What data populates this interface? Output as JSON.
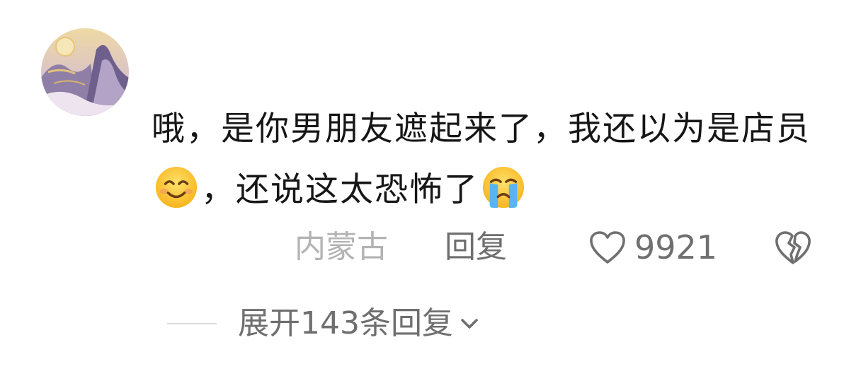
{
  "comment": {
    "avatar_icon": "landscape-painting-avatar",
    "text_part1": "哦，是你男朋友遮起来了，我还以为是店员",
    "emoji1": "smiling-face-emoji",
    "text_part2": "，还说这太恐怖了",
    "emoji2": "crying-face-emoji"
  },
  "meta": {
    "location": "内蒙古",
    "reply_label": "回复",
    "like_icon": "heart-outline-icon",
    "like_count": "9921",
    "dislike_icon": "broken-heart-icon"
  },
  "replies": {
    "expand_label": "展开143条回复",
    "expand_icon": "chevron-down-icon"
  },
  "colors": {
    "text_primary": "#161616",
    "text_secondary": "#6f6f6f",
    "text_muted": "#b3b3b3",
    "divider": "#dcdcdc"
  }
}
